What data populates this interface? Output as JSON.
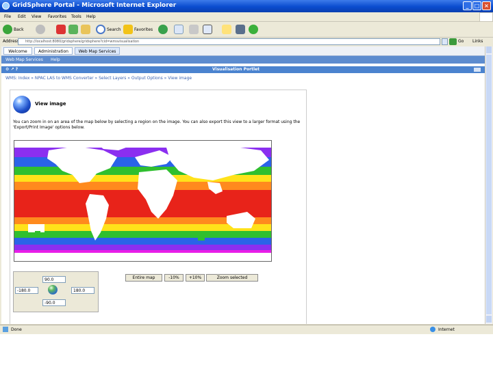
{
  "window": {
    "title": "GridSphere Portal - Microsoft Internet Explorer",
    "menu": [
      "File",
      "Edit",
      "View",
      "Favorites",
      "Tools",
      "Help"
    ]
  },
  "toolbar": {
    "back_label": "Back",
    "search_label": "Search",
    "favorites_label": "Favorites"
  },
  "address": {
    "label": "Address",
    "value": "http://localhost:8080/gridsphere/gridsphere?cid=wmsvisualisation",
    "go_label": "Go",
    "links_label": "Links"
  },
  "portal": {
    "tabs": [
      "Welcome",
      "Administration",
      "Web Map Services"
    ],
    "active_tab": 2,
    "subnav": [
      "Web Map Services",
      "Help"
    ],
    "portlet_title": "Visualisation Portlet",
    "breadcrumb": "WMS: Index » NPAC LAS to WMS Converter » Select Layers » Output Options » View image",
    "view_title": "View image",
    "intro": "You can zoom in on an area of the map below by selecting a region on the image. You can also export this view to a larger format using the 'Export/Print Image' options below.",
    "buttons": [
      "Entire map",
      "-10%",
      "+10%",
      "Zoom selected"
    ],
    "bbox": {
      "north": "90.0",
      "west": "-180.0",
      "east": "180.0",
      "south": "-90.0"
    }
  },
  "status": {
    "left": "Done",
    "zone": "Internet"
  },
  "colors": {
    "title_bar": "#0a4ccf",
    "portal_bar": "#4b83cf",
    "map_red": "#e8231a",
    "map_orange": "#ff8a1e",
    "map_yellow": "#ffe21a",
    "map_green": "#2fbf2f",
    "map_blue": "#2a63e8",
    "map_purple": "#8b2ff0",
    "map_magenta": "#e81ee8"
  }
}
